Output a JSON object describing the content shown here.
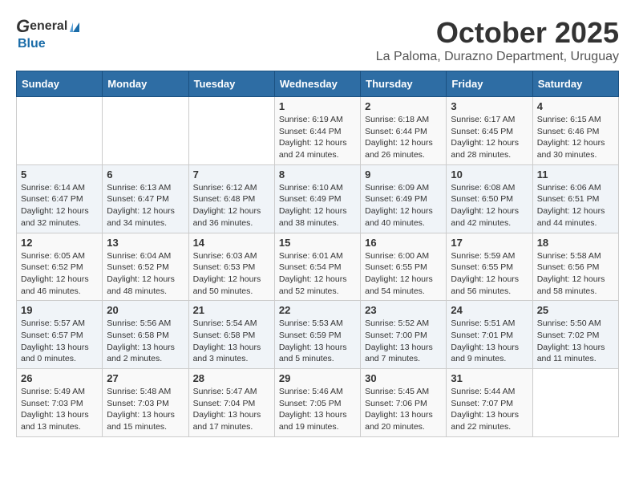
{
  "header": {
    "logo_general": "General",
    "logo_blue": "Blue",
    "month_title": "October 2025",
    "subtitle": "La Paloma, Durazno Department, Uruguay"
  },
  "weekdays": [
    "Sunday",
    "Monday",
    "Tuesday",
    "Wednesday",
    "Thursday",
    "Friday",
    "Saturday"
  ],
  "weeks": [
    [
      {
        "day": "",
        "info": ""
      },
      {
        "day": "",
        "info": ""
      },
      {
        "day": "",
        "info": ""
      },
      {
        "day": "1",
        "info": "Sunrise: 6:19 AM\nSunset: 6:44 PM\nDaylight: 12 hours\nand 24 minutes."
      },
      {
        "day": "2",
        "info": "Sunrise: 6:18 AM\nSunset: 6:44 PM\nDaylight: 12 hours\nand 26 minutes."
      },
      {
        "day": "3",
        "info": "Sunrise: 6:17 AM\nSunset: 6:45 PM\nDaylight: 12 hours\nand 28 minutes."
      },
      {
        "day": "4",
        "info": "Sunrise: 6:15 AM\nSunset: 6:46 PM\nDaylight: 12 hours\nand 30 minutes."
      }
    ],
    [
      {
        "day": "5",
        "info": "Sunrise: 6:14 AM\nSunset: 6:47 PM\nDaylight: 12 hours\nand 32 minutes."
      },
      {
        "day": "6",
        "info": "Sunrise: 6:13 AM\nSunset: 6:47 PM\nDaylight: 12 hours\nand 34 minutes."
      },
      {
        "day": "7",
        "info": "Sunrise: 6:12 AM\nSunset: 6:48 PM\nDaylight: 12 hours\nand 36 minutes."
      },
      {
        "day": "8",
        "info": "Sunrise: 6:10 AM\nSunset: 6:49 PM\nDaylight: 12 hours\nand 38 minutes."
      },
      {
        "day": "9",
        "info": "Sunrise: 6:09 AM\nSunset: 6:49 PM\nDaylight: 12 hours\nand 40 minutes."
      },
      {
        "day": "10",
        "info": "Sunrise: 6:08 AM\nSunset: 6:50 PM\nDaylight: 12 hours\nand 42 minutes."
      },
      {
        "day": "11",
        "info": "Sunrise: 6:06 AM\nSunset: 6:51 PM\nDaylight: 12 hours\nand 44 minutes."
      }
    ],
    [
      {
        "day": "12",
        "info": "Sunrise: 6:05 AM\nSunset: 6:52 PM\nDaylight: 12 hours\nand 46 minutes."
      },
      {
        "day": "13",
        "info": "Sunrise: 6:04 AM\nSunset: 6:52 PM\nDaylight: 12 hours\nand 48 minutes."
      },
      {
        "day": "14",
        "info": "Sunrise: 6:03 AM\nSunset: 6:53 PM\nDaylight: 12 hours\nand 50 minutes."
      },
      {
        "day": "15",
        "info": "Sunrise: 6:01 AM\nSunset: 6:54 PM\nDaylight: 12 hours\nand 52 minutes."
      },
      {
        "day": "16",
        "info": "Sunrise: 6:00 AM\nSunset: 6:55 PM\nDaylight: 12 hours\nand 54 minutes."
      },
      {
        "day": "17",
        "info": "Sunrise: 5:59 AM\nSunset: 6:55 PM\nDaylight: 12 hours\nand 56 minutes."
      },
      {
        "day": "18",
        "info": "Sunrise: 5:58 AM\nSunset: 6:56 PM\nDaylight: 12 hours\nand 58 minutes."
      }
    ],
    [
      {
        "day": "19",
        "info": "Sunrise: 5:57 AM\nSunset: 6:57 PM\nDaylight: 13 hours\nand 0 minutes."
      },
      {
        "day": "20",
        "info": "Sunrise: 5:56 AM\nSunset: 6:58 PM\nDaylight: 13 hours\nand 2 minutes."
      },
      {
        "day": "21",
        "info": "Sunrise: 5:54 AM\nSunset: 6:58 PM\nDaylight: 13 hours\nand 3 minutes."
      },
      {
        "day": "22",
        "info": "Sunrise: 5:53 AM\nSunset: 6:59 PM\nDaylight: 13 hours\nand 5 minutes."
      },
      {
        "day": "23",
        "info": "Sunrise: 5:52 AM\nSunset: 7:00 PM\nDaylight: 13 hours\nand 7 minutes."
      },
      {
        "day": "24",
        "info": "Sunrise: 5:51 AM\nSunset: 7:01 PM\nDaylight: 13 hours\nand 9 minutes."
      },
      {
        "day": "25",
        "info": "Sunrise: 5:50 AM\nSunset: 7:02 PM\nDaylight: 13 hours\nand 11 minutes."
      }
    ],
    [
      {
        "day": "26",
        "info": "Sunrise: 5:49 AM\nSunset: 7:03 PM\nDaylight: 13 hours\nand 13 minutes."
      },
      {
        "day": "27",
        "info": "Sunrise: 5:48 AM\nSunset: 7:03 PM\nDaylight: 13 hours\nand 15 minutes."
      },
      {
        "day": "28",
        "info": "Sunrise: 5:47 AM\nSunset: 7:04 PM\nDaylight: 13 hours\nand 17 minutes."
      },
      {
        "day": "29",
        "info": "Sunrise: 5:46 AM\nSunset: 7:05 PM\nDaylight: 13 hours\nand 19 minutes."
      },
      {
        "day": "30",
        "info": "Sunrise: 5:45 AM\nSunset: 7:06 PM\nDaylight: 13 hours\nand 20 minutes."
      },
      {
        "day": "31",
        "info": "Sunrise: 5:44 AM\nSunset: 7:07 PM\nDaylight: 13 hours\nand 22 minutes."
      },
      {
        "day": "",
        "info": ""
      }
    ]
  ]
}
